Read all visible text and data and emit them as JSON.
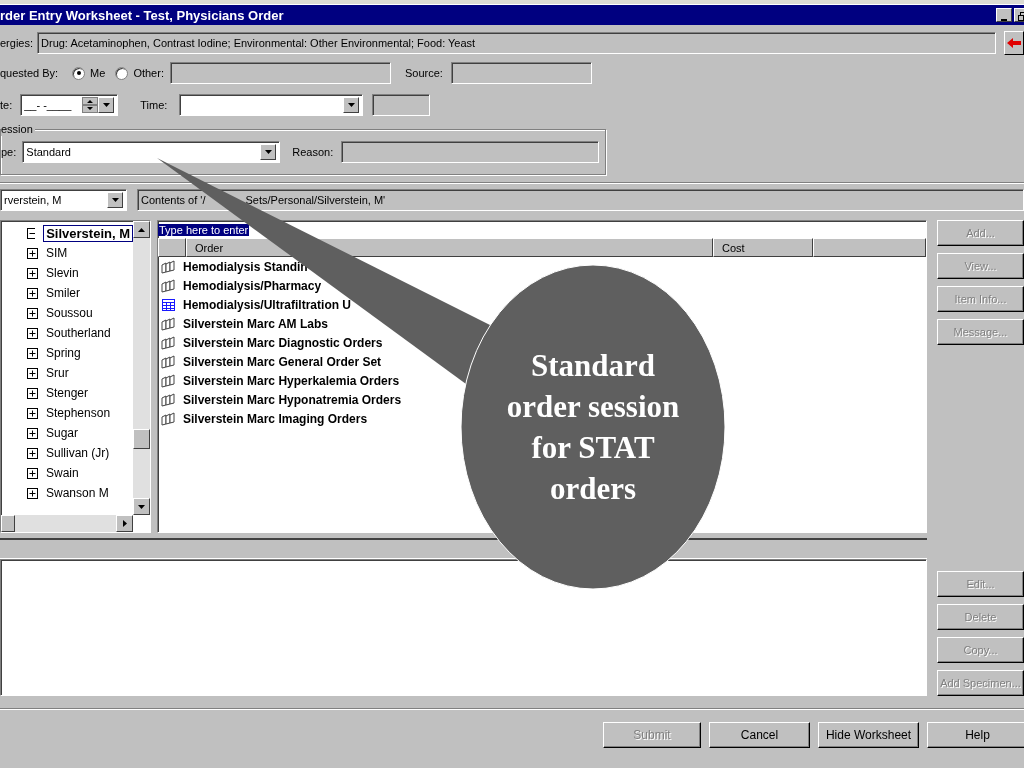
{
  "window": {
    "title": "rder Entry Worksheet - Test, Physicians Order"
  },
  "allergies": {
    "label": "ergies:",
    "value": "Drug: Acetaminophen, Contrast Iodine; Environmental: Other Environmental; Food: Yeast"
  },
  "requested_by": {
    "label": "quested By:",
    "options": [
      {
        "label": "Me",
        "selected": true
      },
      {
        "label": "Other:",
        "selected": false
      }
    ],
    "source_label": "Source:"
  },
  "date": {
    "label": "te:",
    "value": "__-   -____"
  },
  "time": {
    "label": "Time:"
  },
  "session": {
    "legend": "ession",
    "type_label": "pe:",
    "type_value": "Standard",
    "reason_label": "Reason:"
  },
  "folder": {
    "value": "rverstein, M",
    "contents": [
      "Contents of '/",
      "Sets/Personal/Silverstein, M'"
    ]
  },
  "tree": {
    "items": [
      {
        "label": "Silverstein, M",
        "expanded": true,
        "selected": true
      },
      {
        "label": "SIM",
        "expanded": false,
        "selected": false
      },
      {
        "label": "Slevin",
        "expanded": false,
        "selected": false
      },
      {
        "label": "Smiler",
        "expanded": false,
        "selected": false
      },
      {
        "label": "Soussou",
        "expanded": false,
        "selected": false
      },
      {
        "label": "Southerland",
        "expanded": false,
        "selected": false
      },
      {
        "label": "Spring",
        "expanded": false,
        "selected": false
      },
      {
        "label": "Srur",
        "expanded": false,
        "selected": false
      },
      {
        "label": "Stenger",
        "expanded": false,
        "selected": false
      },
      {
        "label": "Stephenson",
        "expanded": false,
        "selected": false
      },
      {
        "label": "Sugar",
        "expanded": false,
        "selected": false
      },
      {
        "label": "Sullivan (Jr)",
        "expanded": false,
        "selected": false
      },
      {
        "label": "Swain",
        "expanded": false,
        "selected": false
      },
      {
        "label": "Swanson M",
        "expanded": false,
        "selected": false
      }
    ]
  },
  "orders": {
    "filter": "Type here to enter",
    "columns": [
      "Order",
      "Cost"
    ],
    "rows": [
      {
        "kind": "set",
        "label": "Hemodialysis Standin"
      },
      {
        "kind": "set",
        "label": "Hemodialysis/Pharmacy"
      },
      {
        "kind": "table",
        "label": "Hemodialysis/Ultrafiltration U"
      },
      {
        "kind": "set",
        "label": "Silverstein Marc AM Labs"
      },
      {
        "kind": "set",
        "label": "Silverstein Marc Diagnostic Orders"
      },
      {
        "kind": "set",
        "label": "Silverstein Marc General Order Set"
      },
      {
        "kind": "set",
        "label": "Silverstein Marc Hyperkalemia Orders"
      },
      {
        "kind": "set",
        "label": "Silverstein Marc Hyponatremia Orders"
      },
      {
        "kind": "set",
        "label": "Silverstein Marc Imaging Orders"
      }
    ]
  },
  "side_buttons_top": [
    {
      "label": "Add...",
      "disabled": true
    },
    {
      "label": "View...",
      "disabled": true
    },
    {
      "label": "Item Info...",
      "disabled": true
    },
    {
      "label": "Message...",
      "disabled": true
    }
  ],
  "side_buttons_bottom": [
    {
      "label": "Edit...",
      "disabled": true
    },
    {
      "label": "Delete",
      "disabled": true
    },
    {
      "label": "Copy...",
      "disabled": true
    },
    {
      "label": "Add Specimen...",
      "disabled": true
    }
  ],
  "footer_buttons": [
    {
      "label": "Submit",
      "disabled": true
    },
    {
      "label": "Cancel",
      "disabled": false
    },
    {
      "label": "Hide Worksheet",
      "disabled": false
    },
    {
      "label": "Help",
      "disabled": false
    }
  ],
  "callout": {
    "text": "Standard order session for STAT orders"
  }
}
